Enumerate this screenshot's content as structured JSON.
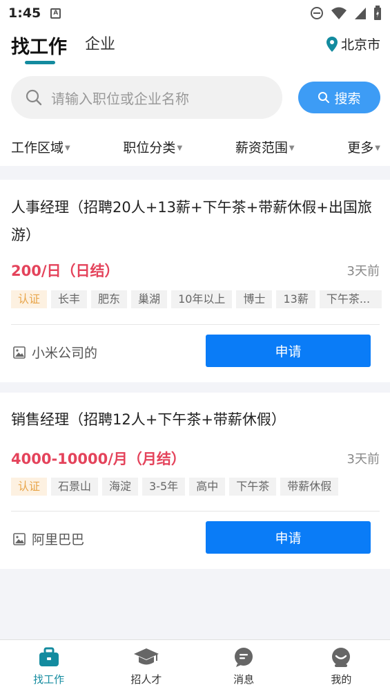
{
  "status": {
    "time": "1:45"
  },
  "header": {
    "tab_active": "找工作",
    "tab_other": "企业",
    "city": "北京市"
  },
  "search": {
    "placeholder": "请输入职位或企业名称",
    "button_label": "搜索"
  },
  "filters": [
    "工作区域",
    "职位分类",
    "薪资范围",
    "更多"
  ],
  "jobs": [
    {
      "title": "人事经理（招聘20人+13薪+下午茶+带薪休假+出国旅游）",
      "salary": "200/日（日结）",
      "posted": "3天前",
      "tags": [
        "认证",
        "长丰",
        "肥东",
        "巢湖",
        "10年以上",
        "博士",
        "13薪",
        "下午茶..."
      ],
      "company": "小米公司的",
      "apply_label": "申请"
    },
    {
      "title": "销售经理（招聘12人+下午茶+带薪休假）",
      "salary": "4000-10000/月（月结）",
      "posted": "3天前",
      "tags": [
        "认证",
        "石景山",
        "海淀",
        "3-5年",
        "高中",
        "下午茶",
        "带薪休假"
      ],
      "company": "阿里巴巴",
      "apply_label": "申请"
    }
  ],
  "bottom_nav": [
    {
      "label": "找工作",
      "icon": "briefcase-icon",
      "active": true
    },
    {
      "label": "招人才",
      "icon": "graduation-cap-icon",
      "active": false
    },
    {
      "label": "消息",
      "icon": "message-icon",
      "active": false
    },
    {
      "label": "我的",
      "icon": "profile-icon",
      "active": false
    }
  ],
  "colors": {
    "accent": "#138b9f",
    "primary_button": "#0a7cf7",
    "salary": "#e4435b",
    "cert_tag": "#e8a54a"
  }
}
